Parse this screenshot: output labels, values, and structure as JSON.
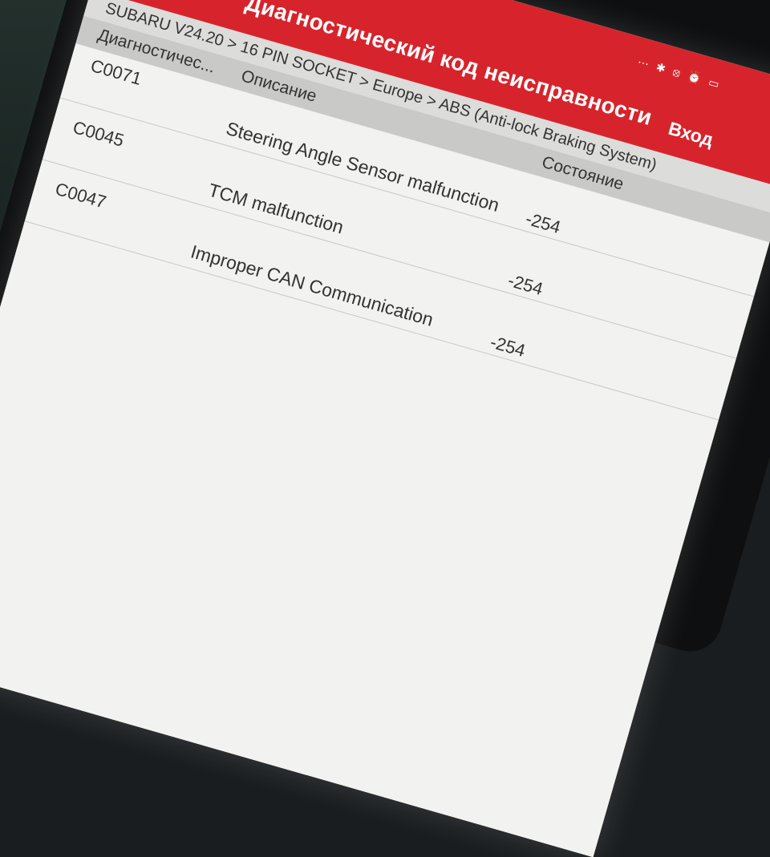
{
  "app": {
    "title": "Диагностический код неисправности",
    "login_label": "Вход",
    "status_icons": "⋯ ✱ ⦻ ⏰ ▭"
  },
  "breadcrumb": "SUBARU V24.20 > 16 PIN SOCKET > Europe > ABS (Anti-lock Braking System)",
  "table": {
    "headers": {
      "code": "Диагностичес...",
      "description": "Описание",
      "state": "Состояние"
    },
    "rows": [
      {
        "code": "C0071",
        "description": "Steering Angle Sensor malfunction",
        "state": "-254"
      },
      {
        "code": "C0045",
        "description": "TCM malfunction",
        "state": "-254"
      },
      {
        "code": "C0047",
        "description": "Improper CAN Communication",
        "state": "-254"
      }
    ]
  },
  "colors": {
    "accent": "#d7242c",
    "screen_bg": "#f2f2f0"
  }
}
